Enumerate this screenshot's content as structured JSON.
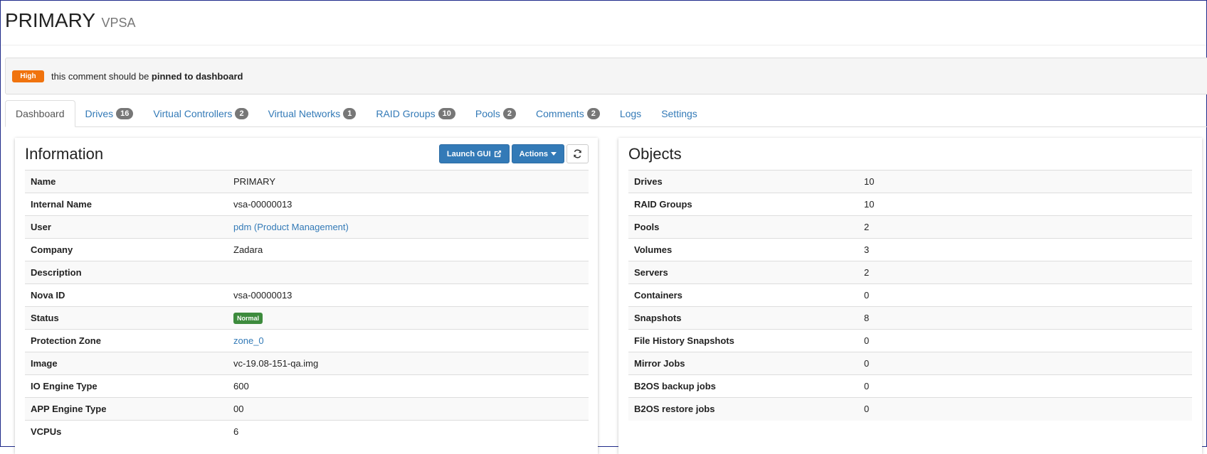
{
  "header": {
    "title": "PRIMARY",
    "subtitle": "VPSA"
  },
  "alert": {
    "priority": "High",
    "text_prefix": "this comment should be ",
    "text_bold": "pinned to dashboard"
  },
  "tabs": [
    {
      "label": "Dashboard",
      "count": null,
      "active": true
    },
    {
      "label": "Drives",
      "count": "16"
    },
    {
      "label": "Virtual Controllers",
      "count": "2"
    },
    {
      "label": "Virtual Networks",
      "count": "1"
    },
    {
      "label": "RAID Groups",
      "count": "10"
    },
    {
      "label": "Pools",
      "count": "2"
    },
    {
      "label": "Comments",
      "count": "2"
    },
    {
      "label": "Logs",
      "count": null
    },
    {
      "label": "Settings",
      "count": null
    }
  ],
  "info": {
    "title": "Information",
    "launch_label": "Launch GUI",
    "actions_label": "Actions",
    "rows": [
      {
        "key": "Name",
        "value": "PRIMARY"
      },
      {
        "key": "Internal Name",
        "value": "vsa-00000013"
      },
      {
        "key": "User",
        "value": "pdm (Product Management)"
      },
      {
        "key": "Company",
        "value": "Zadara"
      },
      {
        "key": "Description",
        "value": ""
      },
      {
        "key": "Nova ID",
        "value": "vsa-00000013"
      },
      {
        "key": "Status",
        "value": "Normal"
      },
      {
        "key": "Protection Zone",
        "value": "zone_0"
      },
      {
        "key": "Image",
        "value": "vc-19.08-151-qa.img"
      },
      {
        "key": "IO Engine Type",
        "value": "600"
      },
      {
        "key": "APP Engine Type",
        "value": "00"
      },
      {
        "key": "VCPUs",
        "value": "6"
      }
    ]
  },
  "objects": {
    "title": "Objects",
    "rows": [
      {
        "key": "Drives",
        "value": "10"
      },
      {
        "key": "RAID Groups",
        "value": "10"
      },
      {
        "key": "Pools",
        "value": "2"
      },
      {
        "key": "Volumes",
        "value": "3"
      },
      {
        "key": "Servers",
        "value": "2"
      },
      {
        "key": "Containers",
        "value": "0"
      },
      {
        "key": "Snapshots",
        "value": "8"
      },
      {
        "key": "File History Snapshots",
        "value": "0"
      },
      {
        "key": "Mirror Jobs",
        "value": "0"
      },
      {
        "key": "B2OS backup jobs",
        "value": "0"
      },
      {
        "key": "B2OS restore jobs",
        "value": "0"
      }
    ]
  },
  "colors": {
    "primary": "#337ab7",
    "high": "#f0730e",
    "normal": "#3d8b3d",
    "badge": "#777777"
  }
}
